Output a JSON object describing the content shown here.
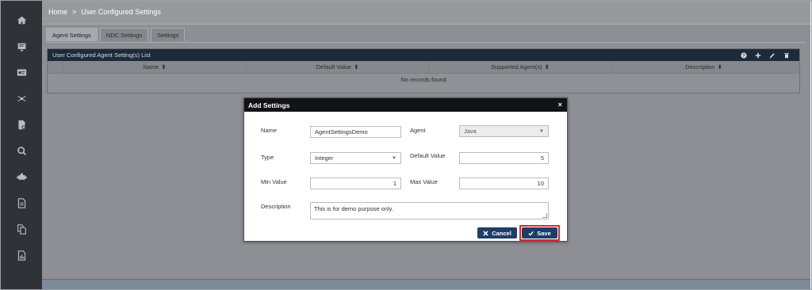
{
  "breadcrumb": {
    "home": "Home",
    "separator": ">",
    "current": "User Configured Settings"
  },
  "tabs": [
    {
      "label": "Agent Settings",
      "active": true
    },
    {
      "label": "NDC Settings",
      "active": false
    },
    {
      "label": "Settings",
      "active": false
    }
  ],
  "panel": {
    "title": "User Configured Agent Setting(s) List",
    "tools": [
      "help-icon",
      "add-icon",
      "edit-icon",
      "delete-icon"
    ],
    "columns": [
      {
        "label": "Name",
        "sort": "⬍"
      },
      {
        "label": "Default Value",
        "sort": "⬍"
      },
      {
        "label": "Supported Agent(s)",
        "sort": "⬍"
      },
      {
        "label": "Description",
        "sort": "⬍"
      }
    ],
    "empty_text": "No records found"
  },
  "sidebar": {
    "icons": [
      "home-icon",
      "monitor-icon",
      "id-card-icon",
      "network-icon",
      "file-settings-icon",
      "search-icon",
      "puzzle-icon",
      "document-icon",
      "files-icon",
      "report-icon"
    ]
  },
  "dialog": {
    "title": "Add Settings",
    "close": "×",
    "name_label": "Name",
    "name_value": "AgentSettingsDemo",
    "agent_label": "Agent",
    "agent_value": "Java",
    "type_label": "Type",
    "type_value": "Integer",
    "default_label": "Default Value",
    "default_value": "5",
    "min_label": "Min Value",
    "min_value": "1",
    "max_label": "Max Value",
    "max_value": "10",
    "desc_label": "Description",
    "desc_value": "This is for demo purpose only.",
    "cancel_label": "Cancel",
    "save_label": "Save",
    "caret": "▼"
  },
  "colors": {
    "sidebar": "#2f3237",
    "overlay": "#97999d",
    "panel_header": "#1d2a3a",
    "dialog_header": "#111315",
    "button": "#1f3d66",
    "highlight": "#e0252b"
  }
}
